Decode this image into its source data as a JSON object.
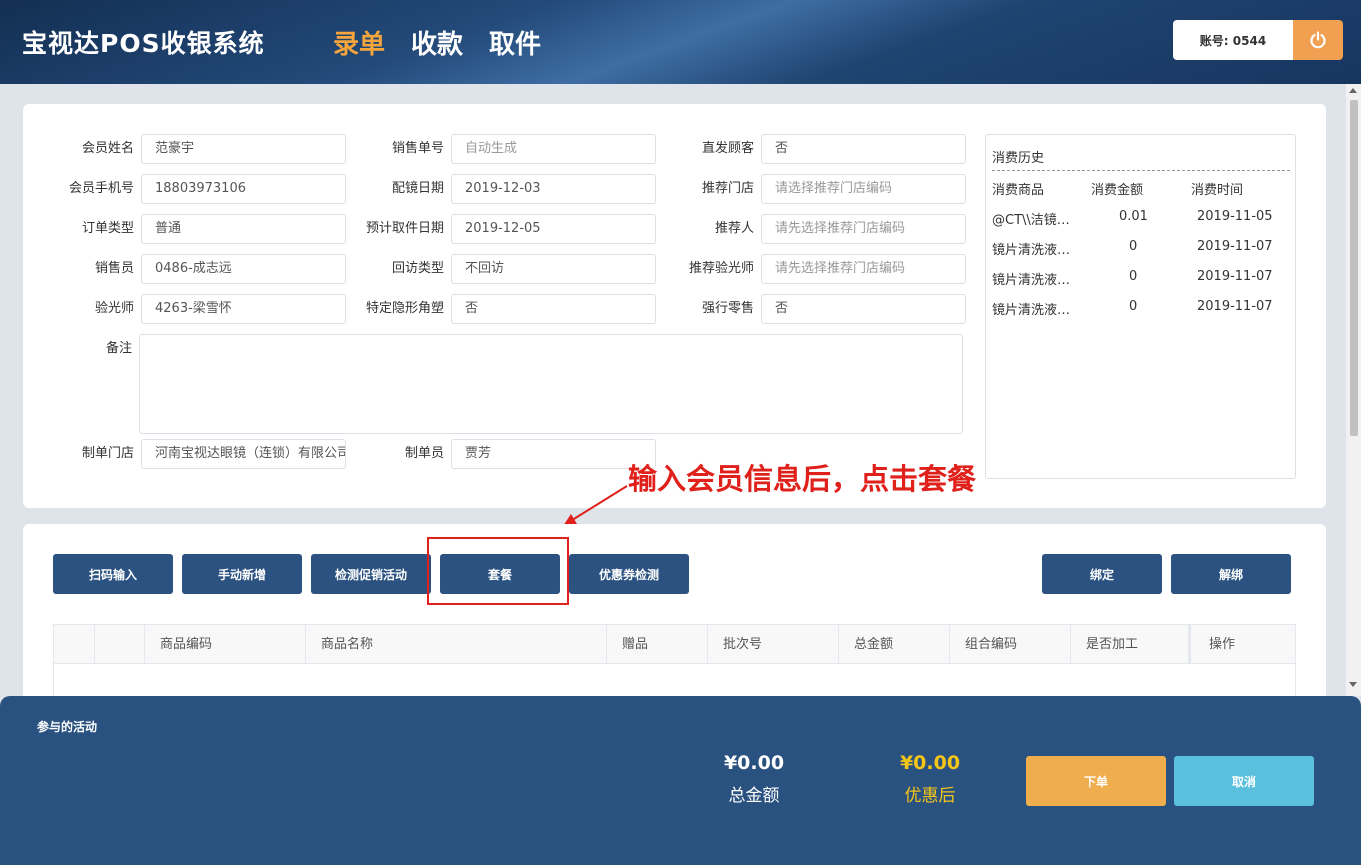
{
  "header": {
    "app_title": "宝视达POS收银系统",
    "nav": [
      "录单",
      "收款",
      "取件"
    ],
    "active_nav": "录单",
    "account": "账号: 0544",
    "power_icon": "power-icon"
  },
  "form": {
    "member_name": {
      "label": "会员姓名",
      "value": "范豪宇"
    },
    "sales_no": {
      "label": "销售单号",
      "placeholder": "自动生成"
    },
    "direct_ship": {
      "label": "直发顾客",
      "value": "否"
    },
    "member_phone": {
      "label": "会员手机号",
      "value": "18803973106"
    },
    "fitting_date": {
      "label": "配镜日期",
      "value": "2019-12-03"
    },
    "recommend_store": {
      "label": "推荐门店",
      "placeholder": "请选择推荐门店编码"
    },
    "order_type": {
      "label": "订单类型",
      "value": "普通"
    },
    "pickup_date": {
      "label": "预计取件日期",
      "value": "2019-12-05"
    },
    "recommender": {
      "label": "推荐人",
      "placeholder": "请先选择推荐门店编码"
    },
    "salesperson": {
      "label": "销售员",
      "value": "0486-成志远"
    },
    "revisit_type": {
      "label": "回访类型",
      "value": "不回访"
    },
    "recommend_optometrist": {
      "label": "推荐验光师",
      "placeholder": "请先选择推荐门店编码"
    },
    "optometrist": {
      "label": "验光师",
      "value": "4263-梁雪怀"
    },
    "special_lens": {
      "label": "特定隐形角塑",
      "value": "否"
    },
    "forced_retail": {
      "label": "强行零售",
      "value": "否"
    },
    "remarks": {
      "label": "备注",
      "value": ""
    },
    "order_store": {
      "label": "制单门店",
      "value": "河南宝视达眼镜（连锁）有限公司"
    },
    "order_maker": {
      "label": "制单员",
      "value": "贾芳"
    }
  },
  "history": {
    "title": "消费历史",
    "columns": [
      "消费商品",
      "消费金额",
      "消费时间"
    ],
    "rows": [
      {
        "item": "@CT\\\\洁镜…",
        "amount": "0.01",
        "time": "2019-11-05"
      },
      {
        "item": "镜片清洗液…",
        "amount": "0",
        "time": "2019-11-07"
      },
      {
        "item": "镜片清洗液…",
        "amount": "0",
        "time": "2019-11-07"
      },
      {
        "item": "镜片清洗液…",
        "amount": "0",
        "time": "2019-11-07"
      }
    ]
  },
  "actions": {
    "scan_input": "扫码输入",
    "manual_add": "手动新增",
    "detect_promo": "检测促销活动",
    "package": "套餐",
    "coupon_check": "优惠券检测",
    "bind": "绑定",
    "unbind": "解绑"
  },
  "table": {
    "columns": [
      "商品编码",
      "商品名称",
      "赠品",
      "批次号",
      "总金额",
      "组合编码",
      "是否加工",
      "操作"
    ]
  },
  "annotation": {
    "text": "输入会员信息后，点击套餐",
    "color": "#e0201b"
  },
  "footer": {
    "activity_label": "参与的活动",
    "total_amount": "¥0.00",
    "total_label": "总金额",
    "discounted_amount": "¥0.00",
    "discounted_label": "优惠后",
    "submit": "下单",
    "cancel": "取消"
  },
  "colors": {
    "header_bg": "#1f4471",
    "primary_btn": "#2b5281",
    "accent_orange": "#f0ad4e",
    "accent_cyan": "#5bc0de",
    "discount_yellow": "#f5c518"
  }
}
